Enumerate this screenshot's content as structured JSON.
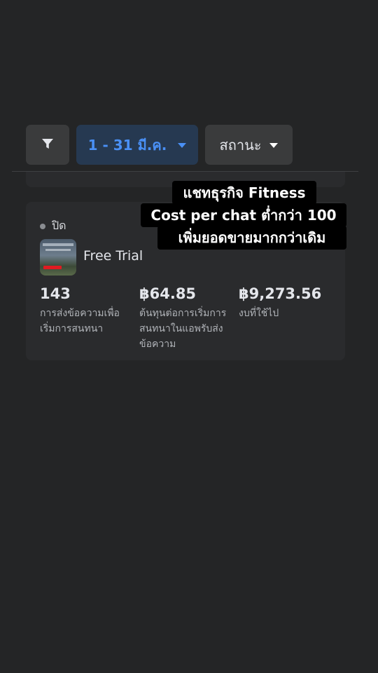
{
  "filters": {
    "filter_icon": "filter-funnel-icon",
    "date_range_label": "1 - 31 มี.ค.",
    "status_label": "สถานะ",
    "accent_color": "#4a90f5"
  },
  "ad_card": {
    "status": "ปิด",
    "ad_name": "Free Trial",
    "metrics": [
      {
        "value": "143",
        "label": "การส่งข้อความเพื่อเริ่มการสนทนา"
      },
      {
        "value": "฿64.85",
        "label": "ต้นทุนต่อการเริ่มการสนทนาในแอพรับส่งข้อความ"
      },
      {
        "value": "฿9,273.56",
        "label": "งบที่ใช้ไป"
      }
    ]
  },
  "caption": {
    "line1": "แชทธุรกิจ Fitness",
    "line2": "Cost per chat ต่ำกว่า 100",
    "line3": "เพิ่มยอดขายมากกว่าเดิม"
  }
}
